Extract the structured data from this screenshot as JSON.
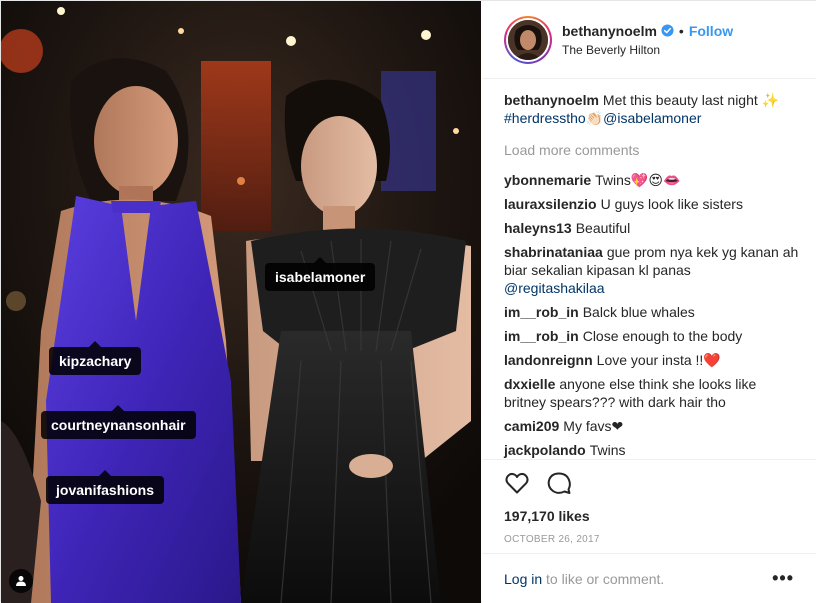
{
  "photo": {
    "tags": [
      "isabelamoner",
      "kipzachary",
      "courtneynansonhair",
      "jovanifashions"
    ],
    "user_tag_icon": "user-icon"
  },
  "header": {
    "username": "bethanynoelm",
    "verified_icon": "verified-badge-icon",
    "separator": "•",
    "follow_label": "Follow",
    "location": "The Beverly Hilton"
  },
  "caption": {
    "username": "bethanynoelm",
    "text": "Met this beauty last night ✨",
    "hashtag": "#herdresstho",
    "emoji": "👏🏻",
    "mention": "@isabelamoner"
  },
  "load_more": "Load more comments",
  "comments": [
    {
      "user": "ybonnemarie",
      "text": "Twins💖😍👄"
    },
    {
      "user": "lauraxsilenzio",
      "text": "U guys look like sisters"
    },
    {
      "user": "haleyns13",
      "text": "Beautiful"
    },
    {
      "user": "shabrinataniaa",
      "text": "gue prom nya kek yg kanan ah biar sekalian kipasan kl panas",
      "mention": "@regitashakilaa"
    },
    {
      "user": "im__rob_in",
      "text": "Balck blue whales"
    },
    {
      "user": "im__rob_in",
      "text": "Close enough to the body"
    },
    {
      "user": "landonreignn",
      "text": "Love your insta !!❤️"
    },
    {
      "user": "dxxielle",
      "text": "anyone else think she looks like britney spears??? with dark hair tho"
    },
    {
      "user": "cami209",
      "text": "My favs❤"
    },
    {
      "user": "jackpolando",
      "text": "Twins"
    }
  ],
  "actions": {
    "like_icon": "heart-icon",
    "comment_icon": "comment-icon",
    "likes": "197,170 likes",
    "date": "OCTOBER 26, 2017"
  },
  "footer": {
    "login": "Log in",
    "rest": "to like or comment.",
    "more": "•••"
  },
  "colors": {
    "accent": "#3897f0",
    "link": "#003569",
    "muted": "#999999",
    "dress_blue": "#4a2fd0"
  }
}
